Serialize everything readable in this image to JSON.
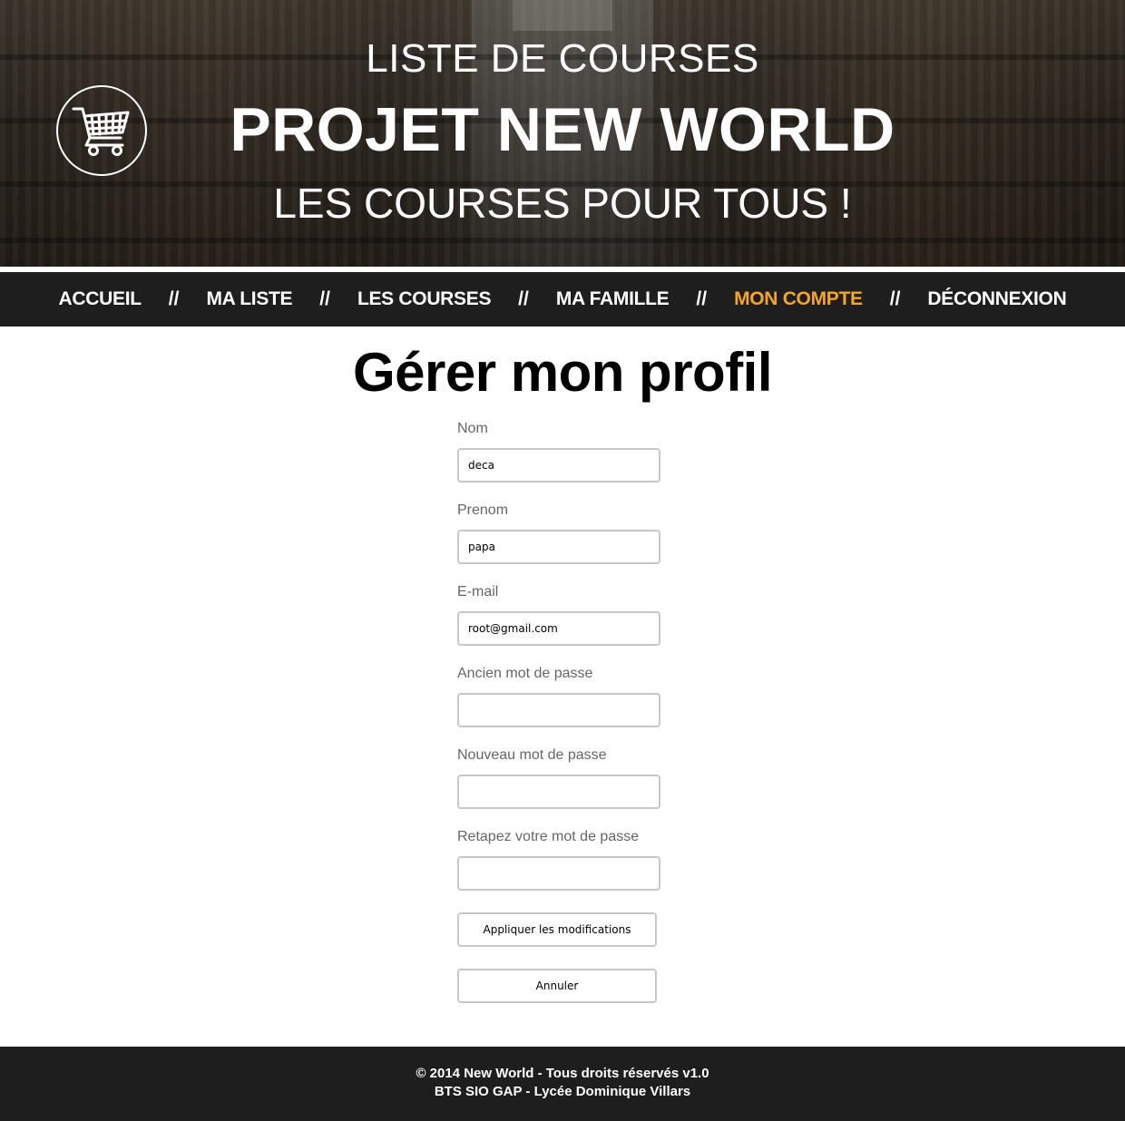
{
  "header": {
    "line1": "LISTE DE COURSES",
    "line2": "PROJET NEW WORLD",
    "line3": "LES COURSES POUR TOUS !",
    "logo_icon": "shopping-cart-icon"
  },
  "nav": {
    "separator": "//",
    "items": [
      {
        "label": "ACCUEIL",
        "active": false
      },
      {
        "label": "MA LISTE",
        "active": false
      },
      {
        "label": "LES COURSES",
        "active": false
      },
      {
        "label": "MA FAMILLE",
        "active": false
      },
      {
        "label": "MON COMPTE",
        "active": true
      },
      {
        "label": "DÉCONNEXION",
        "active": false
      }
    ],
    "active_color": "#f5a623"
  },
  "main": {
    "title": "Gérer mon profil",
    "fields": {
      "nom": {
        "label": "Nom",
        "value": "deca"
      },
      "prenom": {
        "label": "Prenom",
        "value": "papa"
      },
      "email": {
        "label": "E-mail",
        "value": "root@gmail.com"
      },
      "old_password": {
        "label": "Ancien mot de passe",
        "value": ""
      },
      "new_password": {
        "label": "Nouveau mot de passe",
        "value": ""
      },
      "confirm_password": {
        "label": "Retapez votre mot de passe",
        "value": ""
      }
    },
    "apply_button": "Appliquer les modifications",
    "cancel_button": "Annuler"
  },
  "footer": {
    "line1": "© 2014 New World - Tous droits réservés v1.0",
    "line2": "BTS SIO GAP - Lycée Dominique Villars"
  }
}
